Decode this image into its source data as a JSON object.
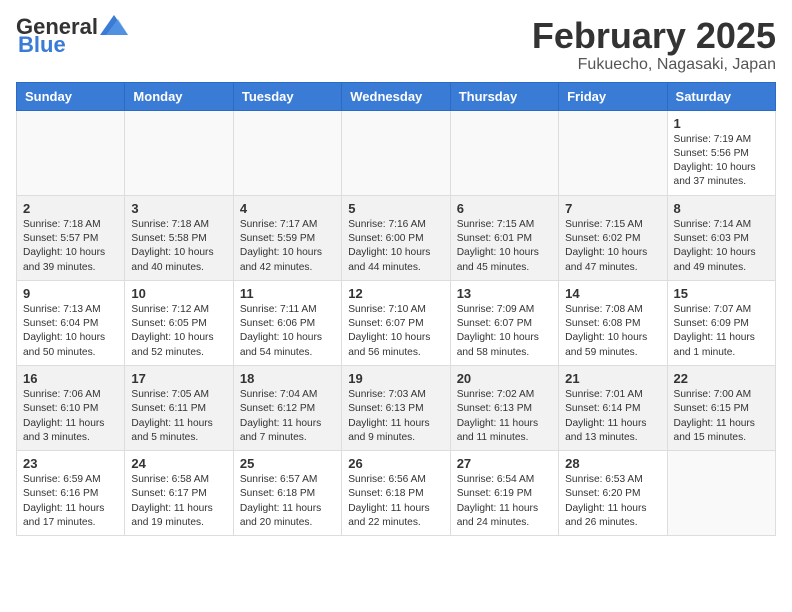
{
  "header": {
    "logo_general": "General",
    "logo_blue": "Blue",
    "month": "February 2025",
    "location": "Fukuecho, Nagasaki, Japan"
  },
  "weekdays": [
    "Sunday",
    "Monday",
    "Tuesday",
    "Wednesday",
    "Thursday",
    "Friday",
    "Saturday"
  ],
  "weeks": [
    [
      {
        "day": "",
        "info": ""
      },
      {
        "day": "",
        "info": ""
      },
      {
        "day": "",
        "info": ""
      },
      {
        "day": "",
        "info": ""
      },
      {
        "day": "",
        "info": ""
      },
      {
        "day": "",
        "info": ""
      },
      {
        "day": "1",
        "info": "Sunrise: 7:19 AM\nSunset: 5:56 PM\nDaylight: 10 hours\nand 37 minutes."
      }
    ],
    [
      {
        "day": "2",
        "info": "Sunrise: 7:18 AM\nSunset: 5:57 PM\nDaylight: 10 hours\nand 39 minutes."
      },
      {
        "day": "3",
        "info": "Sunrise: 7:18 AM\nSunset: 5:58 PM\nDaylight: 10 hours\nand 40 minutes."
      },
      {
        "day": "4",
        "info": "Sunrise: 7:17 AM\nSunset: 5:59 PM\nDaylight: 10 hours\nand 42 minutes."
      },
      {
        "day": "5",
        "info": "Sunrise: 7:16 AM\nSunset: 6:00 PM\nDaylight: 10 hours\nand 44 minutes."
      },
      {
        "day": "6",
        "info": "Sunrise: 7:15 AM\nSunset: 6:01 PM\nDaylight: 10 hours\nand 45 minutes."
      },
      {
        "day": "7",
        "info": "Sunrise: 7:15 AM\nSunset: 6:02 PM\nDaylight: 10 hours\nand 47 minutes."
      },
      {
        "day": "8",
        "info": "Sunrise: 7:14 AM\nSunset: 6:03 PM\nDaylight: 10 hours\nand 49 minutes."
      }
    ],
    [
      {
        "day": "9",
        "info": "Sunrise: 7:13 AM\nSunset: 6:04 PM\nDaylight: 10 hours\nand 50 minutes."
      },
      {
        "day": "10",
        "info": "Sunrise: 7:12 AM\nSunset: 6:05 PM\nDaylight: 10 hours\nand 52 minutes."
      },
      {
        "day": "11",
        "info": "Sunrise: 7:11 AM\nSunset: 6:06 PM\nDaylight: 10 hours\nand 54 minutes."
      },
      {
        "day": "12",
        "info": "Sunrise: 7:10 AM\nSunset: 6:07 PM\nDaylight: 10 hours\nand 56 minutes."
      },
      {
        "day": "13",
        "info": "Sunrise: 7:09 AM\nSunset: 6:07 PM\nDaylight: 10 hours\nand 58 minutes."
      },
      {
        "day": "14",
        "info": "Sunrise: 7:08 AM\nSunset: 6:08 PM\nDaylight: 10 hours\nand 59 minutes."
      },
      {
        "day": "15",
        "info": "Sunrise: 7:07 AM\nSunset: 6:09 PM\nDaylight: 11 hours\nand 1 minute."
      }
    ],
    [
      {
        "day": "16",
        "info": "Sunrise: 7:06 AM\nSunset: 6:10 PM\nDaylight: 11 hours\nand 3 minutes."
      },
      {
        "day": "17",
        "info": "Sunrise: 7:05 AM\nSunset: 6:11 PM\nDaylight: 11 hours\nand 5 minutes."
      },
      {
        "day": "18",
        "info": "Sunrise: 7:04 AM\nSunset: 6:12 PM\nDaylight: 11 hours\nand 7 minutes."
      },
      {
        "day": "19",
        "info": "Sunrise: 7:03 AM\nSunset: 6:13 PM\nDaylight: 11 hours\nand 9 minutes."
      },
      {
        "day": "20",
        "info": "Sunrise: 7:02 AM\nSunset: 6:13 PM\nDaylight: 11 hours\nand 11 minutes."
      },
      {
        "day": "21",
        "info": "Sunrise: 7:01 AM\nSunset: 6:14 PM\nDaylight: 11 hours\nand 13 minutes."
      },
      {
        "day": "22",
        "info": "Sunrise: 7:00 AM\nSunset: 6:15 PM\nDaylight: 11 hours\nand 15 minutes."
      }
    ],
    [
      {
        "day": "23",
        "info": "Sunrise: 6:59 AM\nSunset: 6:16 PM\nDaylight: 11 hours\nand 17 minutes."
      },
      {
        "day": "24",
        "info": "Sunrise: 6:58 AM\nSunset: 6:17 PM\nDaylight: 11 hours\nand 19 minutes."
      },
      {
        "day": "25",
        "info": "Sunrise: 6:57 AM\nSunset: 6:18 PM\nDaylight: 11 hours\nand 20 minutes."
      },
      {
        "day": "26",
        "info": "Sunrise: 6:56 AM\nSunset: 6:18 PM\nDaylight: 11 hours\nand 22 minutes."
      },
      {
        "day": "27",
        "info": "Sunrise: 6:54 AM\nSunset: 6:19 PM\nDaylight: 11 hours\nand 24 minutes."
      },
      {
        "day": "28",
        "info": "Sunrise: 6:53 AM\nSunset: 6:20 PM\nDaylight: 11 hours\nand 26 minutes."
      },
      {
        "day": "",
        "info": ""
      }
    ]
  ]
}
